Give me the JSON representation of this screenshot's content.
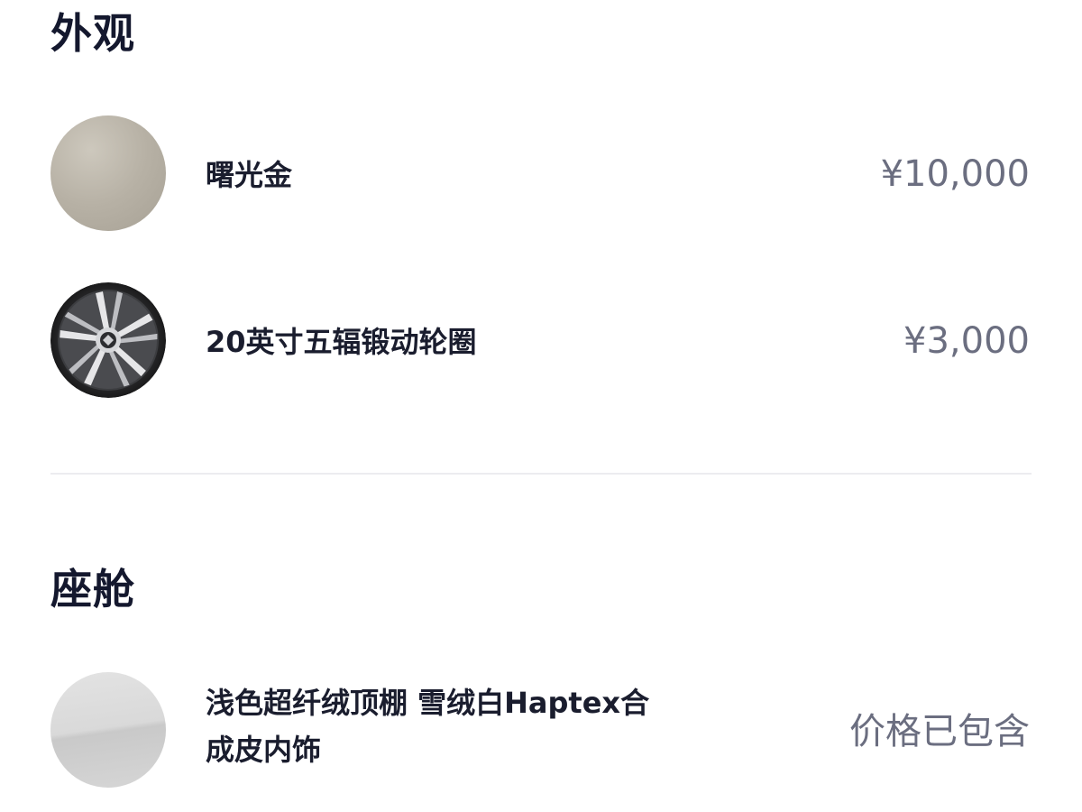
{
  "sections": {
    "exterior": {
      "title": "外观",
      "items": [
        {
          "name": "曙光金",
          "price": "¥10,000",
          "swatch": "gold-paint-swatch"
        },
        {
          "name": "20英寸五辐锻动轮圈",
          "price": "¥3,000",
          "swatch": "wheel-rim-icon"
        }
      ]
    },
    "cabin": {
      "title": "座舱",
      "items": [
        {
          "name_line1": "浅色超纤绒顶棚 雪绒白Haptex合",
          "name_line2": "成皮内饰",
          "price": "价格已包含",
          "swatch": "interior-color-swatch"
        }
      ]
    }
  },
  "colors": {
    "title": "#14182e",
    "text": "#1a1d2e",
    "price": "#6b6e80",
    "divider": "#ececf0",
    "gold_paint": "#b7b1a5",
    "interior_white": "#d9d9d9"
  }
}
